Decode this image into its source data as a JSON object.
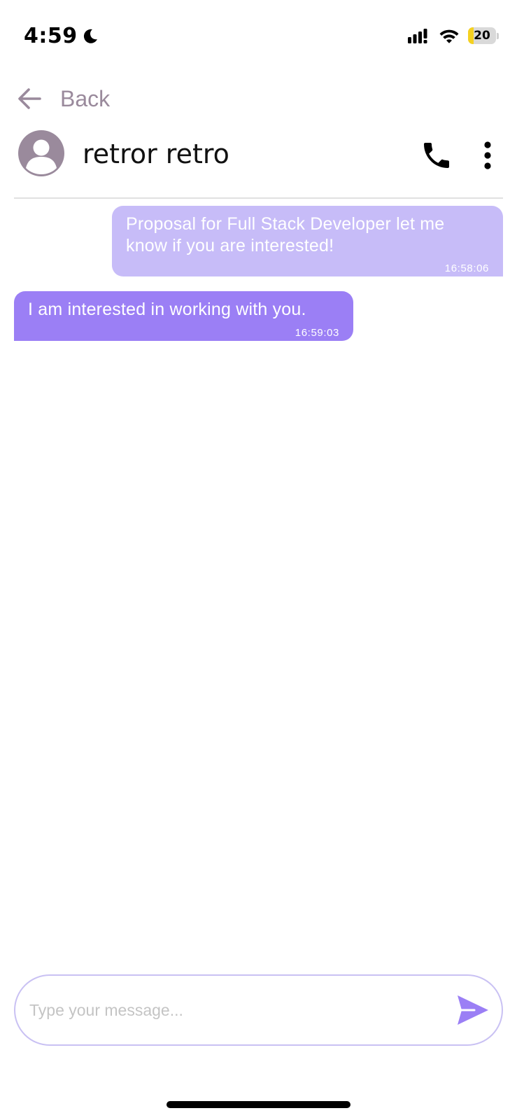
{
  "status_bar": {
    "time": "4:59",
    "battery_level": "20",
    "battery_fraction": 0.2,
    "icons": [
      "moon-icon",
      "cellular-signal-icon",
      "wifi-icon",
      "battery-icon"
    ]
  },
  "navigation": {
    "back_label": "Back",
    "back_icon": "arrow-left-icon"
  },
  "chat_header": {
    "contact_name": "retror retro",
    "avatar_icon": "user-avatar-icon",
    "actions": [
      "phone-icon",
      "more-vertical-icon"
    ]
  },
  "messages": [
    {
      "direction": "outgoing",
      "text": "Proposal for Full Stack Developer let me know if you are interested!",
      "time": "16:58:06"
    },
    {
      "direction": "incoming",
      "text": "I am interested in working with you.",
      "time": "16:59:03"
    }
  ],
  "composer": {
    "value": "",
    "placeholder": "Type your message...",
    "send_icon": "send-icon"
  },
  "colors": {
    "accent": "#9b7ff5",
    "outgoing_bubble": "#c7bcf8",
    "incoming_bubble": "#9b7ff5",
    "muted": "#9a8a9c",
    "composer_border": "#c9c1f3",
    "battery_fill": "#f5d120"
  }
}
